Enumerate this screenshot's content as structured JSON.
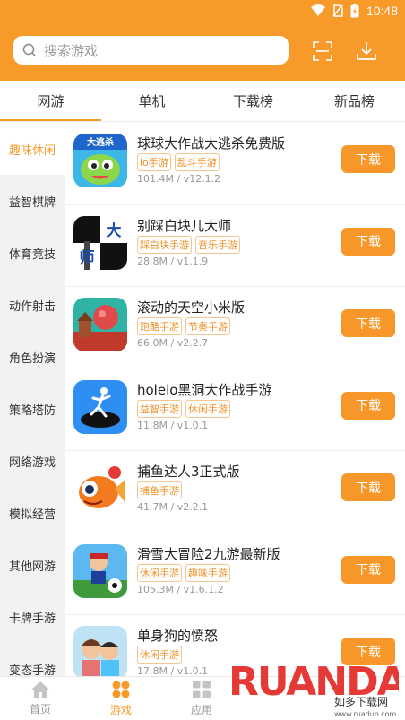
{
  "statusbar": {
    "time": "10:48"
  },
  "search": {
    "placeholder": "搜索游戏"
  },
  "tabs": [
    {
      "label": "网游"
    },
    {
      "label": "单机"
    },
    {
      "label": "下载榜"
    },
    {
      "label": "新品榜"
    }
  ],
  "sidebar": {
    "items": [
      {
        "label": "趣味休闲"
      },
      {
        "label": "益智棋牌"
      },
      {
        "label": "体育竞技"
      },
      {
        "label": "动作射击"
      },
      {
        "label": "角色扮演"
      },
      {
        "label": "策略塔防"
      },
      {
        "label": "网络游戏"
      },
      {
        "label": "模拟经营"
      },
      {
        "label": "其他网游"
      },
      {
        "label": "卡牌手游"
      },
      {
        "label": "变态手游"
      }
    ]
  },
  "games": [
    {
      "title": "球球大作战大逃杀免费版",
      "tags": [
        "io手游",
        "乱斗手游"
      ],
      "meta": "101.4M / v12.1.2",
      "thumb_text": "大逃杀"
    },
    {
      "title": "别踩白块儿大师",
      "tags": [
        "踩白块手游",
        "音乐手游"
      ],
      "meta": "28.8M / v1.1.9",
      "thumb_text_a": "大",
      "thumb_text_b": "师"
    },
    {
      "title": "滚动的天空小米版",
      "tags": [
        "跑酷手游",
        "节奏手游"
      ],
      "meta": "66.0M / v2.2.7"
    },
    {
      "title": "holeio黑洞大作战手游",
      "tags": [
        "益智手游",
        "休闲手游"
      ],
      "meta": "11.8M / v1.0.1"
    },
    {
      "title": "捕鱼达人3正式版",
      "tags": [
        "捕鱼手游"
      ],
      "meta": "41.7M / v2.2.1"
    },
    {
      "title": "滑雪大冒险2九游最新版",
      "tags": [
        "休闲手游",
        "趣味手游"
      ],
      "meta": "105.3M / v1.6.1.2"
    },
    {
      "title": "单身狗的愤怒",
      "tags": [
        "休闲手游"
      ],
      "meta": "17.8M / v1.0.1"
    }
  ],
  "download_label": "下载",
  "bottomnav": [
    {
      "label": "首页"
    },
    {
      "label": "游戏"
    },
    {
      "label": "应用"
    }
  ],
  "watermark": {
    "brand": "RUANDAO",
    "cn": "如多下载网",
    "url": "www.ruaduo.com"
  },
  "colors": {
    "accent": "#f79a2a",
    "sidebar_bg": "#f2f2f2"
  }
}
